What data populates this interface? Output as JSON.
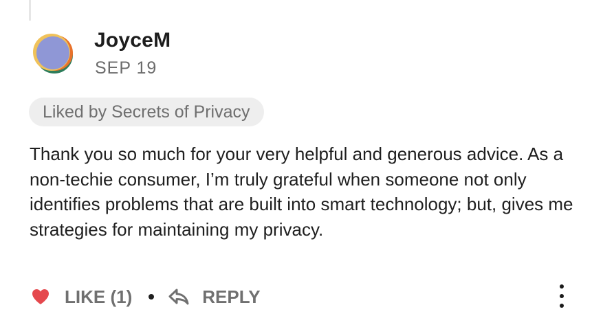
{
  "comment": {
    "username": "JoyceM",
    "date": "SEP  19",
    "liked_by": "Liked by Secrets of Privacy",
    "body": "Thank you so much for your very helpful and generous advice. As a non-techie consumer, I’m truly grateful when someone not only identifies problems that are built into smart technology; but, gives me strategies for maintaining my privacy."
  },
  "actions": {
    "like_label": "LIKE (1)",
    "reply_label": "REPLY",
    "like_icon": "heart-icon",
    "reply_icon": "reply-arrow-icon",
    "more_icon": "more-vertical-icon"
  },
  "colors": {
    "heart": "#e5484d",
    "meta_text": "#6c6c6c",
    "pill_bg": "#eeeeee"
  }
}
